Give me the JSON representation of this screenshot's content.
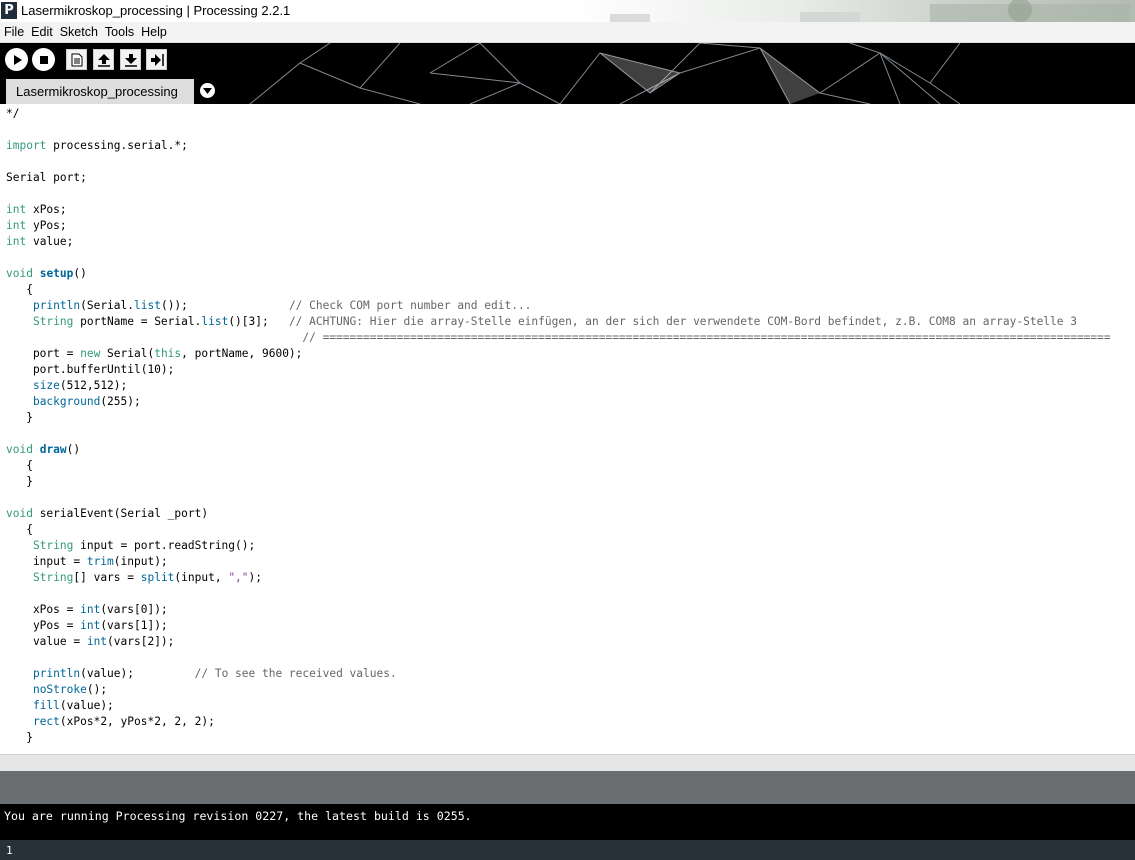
{
  "window": {
    "title": "Lasermikroskop_processing | Processing 2.2.1",
    "app_icon_letter": "P"
  },
  "menu": [
    "File",
    "Edit",
    "Sketch",
    "Tools",
    "Help"
  ],
  "toolbar": {
    "buttons": [
      "run-icon",
      "stop-icon",
      "new-icon",
      "open-icon",
      "save-icon",
      "export-icon"
    ]
  },
  "tab": {
    "label": "Lasermikroskop_processing"
  },
  "code_lines": [
    [
      [
        "",
        "*/"
      ]
    ],
    [],
    [
      [
        "kw",
        "import"
      ],
      [
        "",
        " processing.serial.*;"
      ]
    ],
    [],
    [
      [
        "",
        "Serial port;"
      ]
    ],
    [],
    [
      [
        "kw",
        "int"
      ],
      [
        "",
        " xPos;"
      ]
    ],
    [
      [
        "kw",
        "int"
      ],
      [
        "",
        " yPos;"
      ]
    ],
    [
      [
        "kw",
        "int"
      ],
      [
        "",
        " value;"
      ]
    ],
    [],
    [
      [
        "kw",
        "void"
      ],
      [
        "",
        " "
      ],
      [
        "fn-b",
        "setup"
      ],
      [
        "",
        "()"
      ]
    ],
    [
      [
        "",
        "   {"
      ]
    ],
    [
      [
        "",
        "    "
      ],
      [
        "fn",
        "println"
      ],
      [
        "",
        "(Serial."
      ],
      [
        "fn",
        "list"
      ],
      [
        "",
        "());               "
      ],
      [
        "cm",
        "// Check COM port number and edit..."
      ]
    ],
    [
      [
        "",
        "    "
      ],
      [
        "kw",
        "String"
      ],
      [
        "",
        " portName = Serial."
      ],
      [
        "fn",
        "list"
      ],
      [
        "",
        "()[3];   "
      ],
      [
        "cm",
        "// ACHTUNG: Hier die array-Stelle einfügen, an der sich der verwendete COM-Bord befindet, z.B. COM8 an array-Stelle 3"
      ]
    ],
    [
      [
        "",
        "                                            "
      ],
      [
        "cm",
        "// ====================================================================================================================="
      ]
    ],
    [
      [
        "",
        "    port = "
      ],
      [
        "kw",
        "new"
      ],
      [
        "",
        " Serial("
      ],
      [
        "kw",
        "this"
      ],
      [
        "",
        ", portName, 9600);"
      ]
    ],
    [
      [
        "",
        "    port.bufferUntil(10);"
      ]
    ],
    [
      [
        "",
        "    "
      ],
      [
        "fn",
        "size"
      ],
      [
        "",
        "(512,512);"
      ]
    ],
    [
      [
        "",
        "    "
      ],
      [
        "fn",
        "background"
      ],
      [
        "",
        "(255);"
      ]
    ],
    [
      [
        "",
        "   }"
      ]
    ],
    [],
    [
      [
        "kw",
        "void"
      ],
      [
        "",
        " "
      ],
      [
        "fn-b",
        "draw"
      ],
      [
        "",
        "()"
      ]
    ],
    [
      [
        "",
        "   {"
      ]
    ],
    [
      [
        "",
        "   }"
      ]
    ],
    [],
    [
      [
        "kw",
        "void"
      ],
      [
        "",
        " serialEvent(Serial _port)"
      ]
    ],
    [
      [
        "",
        "   {"
      ]
    ],
    [
      [
        "",
        "    "
      ],
      [
        "kw",
        "String"
      ],
      [
        "",
        " input = port.readString();"
      ]
    ],
    [
      [
        "",
        "    input = "
      ],
      [
        "fn",
        "trim"
      ],
      [
        "",
        "(input);"
      ]
    ],
    [
      [
        "",
        "    "
      ],
      [
        "kw",
        "String"
      ],
      [
        "",
        "[] vars = "
      ],
      [
        "fn",
        "split"
      ],
      [
        "",
        "(input, "
      ],
      [
        "str",
        "\",\""
      ],
      [
        "",
        ");"
      ]
    ],
    [],
    [
      [
        "",
        "    xPos = "
      ],
      [
        "fn",
        "int"
      ],
      [
        "",
        "(vars[0]);"
      ]
    ],
    [
      [
        "",
        "    yPos = "
      ],
      [
        "fn",
        "int"
      ],
      [
        "",
        "(vars[1]);"
      ]
    ],
    [
      [
        "",
        "    value = "
      ],
      [
        "fn",
        "int"
      ],
      [
        "",
        "(vars[2]);"
      ]
    ],
    [],
    [
      [
        "",
        "    "
      ],
      [
        "fn",
        "println"
      ],
      [
        "",
        "(value);         "
      ],
      [
        "cm",
        "// To see the received values."
      ]
    ],
    [
      [
        "",
        "    "
      ],
      [
        "fn",
        "noStroke"
      ],
      [
        "",
        "();"
      ]
    ],
    [
      [
        "",
        "    "
      ],
      [
        "fn",
        "fill"
      ],
      [
        "",
        "(value);"
      ]
    ],
    [
      [
        "",
        "    "
      ],
      [
        "fn",
        "rect"
      ],
      [
        "",
        "(xPos*2, yPos*2, 2, 2);"
      ]
    ],
    [
      [
        "",
        "   }"
      ]
    ]
  ],
  "console": {
    "message": "You are running Processing revision 0227, the latest build is 0255."
  },
  "status": {
    "line_number": "1"
  },
  "colors": {
    "keyword": "#33997e",
    "function": "#006699",
    "comment": "#666666",
    "string": "#7d4793",
    "header_bg": "#000000",
    "message_bar": "#6a6e71",
    "status_bar": "#273238"
  }
}
